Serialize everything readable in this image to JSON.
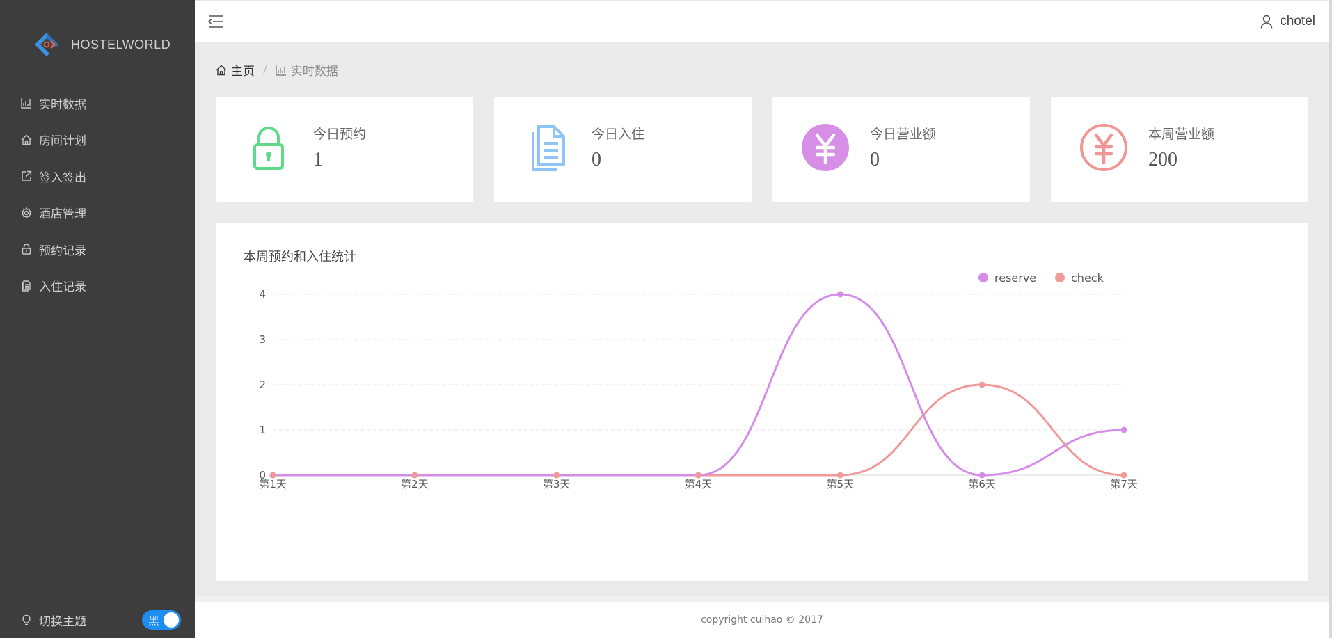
{
  "sidebar": {
    "brand": "HOSTELWORLD",
    "items": [
      {
        "label": "实时数据",
        "icon": "bar-chart-icon"
      },
      {
        "label": "房间计划",
        "icon": "home-icon"
      },
      {
        "label": "签入签出",
        "icon": "external-link-icon"
      },
      {
        "label": "酒店管理",
        "icon": "gear-icon"
      },
      {
        "label": "预约记录",
        "icon": "lock-icon"
      },
      {
        "label": "入住记录",
        "icon": "document-icon"
      }
    ],
    "theme_label": "切换主题",
    "theme_toggle_text": "黑"
  },
  "header": {
    "user": "chotel"
  },
  "breadcrumb": {
    "home": "主页",
    "separator": "/",
    "current": "实时数据"
  },
  "cards": [
    {
      "label": "今日预约",
      "value": "1",
      "icon": "lock-icon",
      "color": "#5fd98a"
    },
    {
      "label": "今日入住",
      "value": "0",
      "icon": "document-icon",
      "color": "#8ec5f5"
    },
    {
      "label": "今日营业额",
      "value": "0",
      "icon": "yen-circle-icon",
      "color": "#d68ee6"
    },
    {
      "label": "本周营业额",
      "value": "200",
      "icon": "yen-circle-outline-icon",
      "color": "#f09696"
    }
  ],
  "chart_data": {
    "type": "line",
    "title": "本周预约和入住统计",
    "categories": [
      "第1天",
      "第2天",
      "第3天",
      "第4天",
      "第5天",
      "第6天",
      "第7天"
    ],
    "series": [
      {
        "name": "reserve",
        "values": [
          0,
          0,
          0,
          0,
          4,
          0,
          1
        ],
        "color": "#d48ee8"
      },
      {
        "name": "check",
        "values": [
          0,
          0,
          0,
          0,
          0,
          2,
          0
        ],
        "color": "#f09a9a"
      }
    ],
    "ylim": [
      0,
      4
    ],
    "yticks": [
      "0",
      "1",
      "2",
      "3",
      "4"
    ],
    "smooth": true,
    "grid": true,
    "legend": "top-right"
  },
  "footer": {
    "text": "copyright cuihao © 2017"
  }
}
